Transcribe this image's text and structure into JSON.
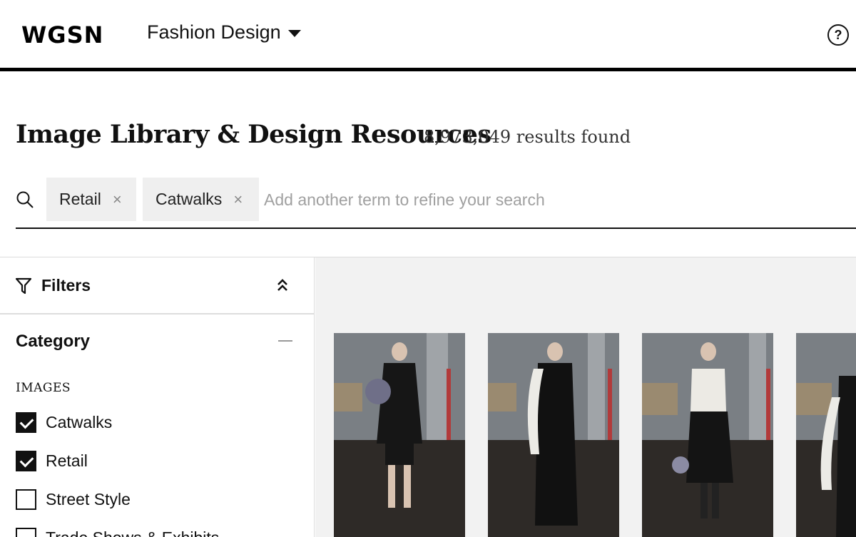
{
  "header": {
    "logo": "WGSN",
    "app_name": "Fashion Design",
    "help": "?"
  },
  "page": {
    "title": "Image Library & Design Resources",
    "result_count": "8,973,049 results found"
  },
  "search": {
    "chips": [
      {
        "label": "Retail",
        "remove": "×"
      },
      {
        "label": "Catwalks",
        "remove": "×"
      }
    ],
    "placeholder": "Add another term to refine your search",
    "value": ""
  },
  "sidebar": {
    "filters_title": "Filters",
    "category_title": "Category",
    "section_label": "IMAGES",
    "options": [
      {
        "label": "Catwalks",
        "checked": true
      },
      {
        "label": "Retail",
        "checked": true
      },
      {
        "label": "Street Style",
        "checked": false
      },
      {
        "label": "Trade Shows & Exhibits",
        "checked": false
      }
    ]
  },
  "icons": {
    "search": "search-icon",
    "filter": "funnel-icon",
    "collapse": "double-chevron-up-icon",
    "category_toggle": "minus-icon",
    "help": "question-circle-icon",
    "app_caret": "caret-down-icon"
  },
  "colors": {
    "text": "#111111",
    "chip_bg": "#efefef",
    "content_bg": "#f2f2f2",
    "placeholder": "#a0a0a0",
    "border": "#dddddd"
  }
}
